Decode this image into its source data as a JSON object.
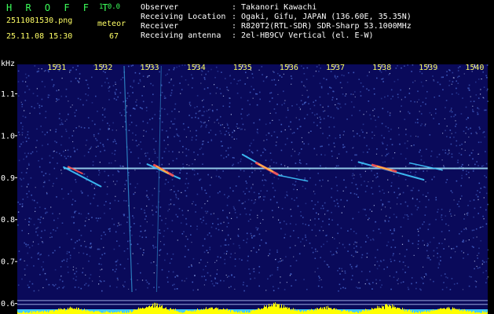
{
  "header": {
    "app_name": "H R O F F T",
    "app_version": "1.0.0",
    "filename": "2511081530.png",
    "datetime": "25.11.08 15:30",
    "event_label": "meteor",
    "event_count": "67"
  },
  "station": {
    "observer": {
      "label": "Observer",
      "value": "Takanori Kawachi"
    },
    "location": {
      "label": "Receiving Location",
      "value": "Ogaki, Gifu, JAPAN (136.60E, 35.35N)"
    },
    "receiver": {
      "label": "Receiver",
      "value": "R820T2(RTL-SDR) SDR-Sharp 53.1000MHz"
    },
    "antenna": {
      "label": "Receiving antenna",
      "value": "2el-HB9CV Vertical (el. E-W)"
    },
    "separator": ":"
  },
  "spectrogram": {
    "y_unit": "kHz",
    "y_ticks": [
      "1.1",
      "1.0",
      "0.9",
      "0.8",
      "0.7",
      "0.6"
    ],
    "y_tick_values": [
      1.1,
      1.0,
      0.9,
      0.8,
      0.7,
      0.6
    ],
    "y_range": [
      0.575,
      1.17
    ],
    "x_ticks": [
      "1531",
      "1532",
      "1533",
      "1534",
      "1535",
      "1536",
      "1537",
      "1538",
      "1539",
      "1540"
    ],
    "x_tick_values": [
      1531,
      1532,
      1533,
      1534,
      1535,
      1536,
      1537,
      1538,
      1539,
      1540
    ],
    "x_range": [
      1530.15,
      1540.28
    ],
    "carrier_khz": 0.922,
    "colors": {
      "background": "#0a0a5a",
      "noise_light": "#4a6ad0",
      "noise_bright": "#d0e0ff",
      "carrier": "#a8e8ff",
      "echo_hot": "#ff5050",
      "echo_warm": "#ffd040",
      "meteor_trail": "#40c8ff",
      "level_bars": "#ffff00",
      "base_band": "#40c8ff",
      "tick_labels": "#ffff66",
      "axis_labels": "#ffffff"
    }
  }
}
